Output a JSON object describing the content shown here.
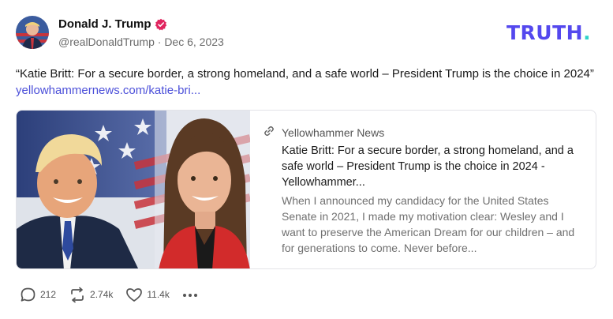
{
  "author": {
    "display_name": "Donald J. Trump",
    "handle": "@realDonaldTrump",
    "separator": " · ",
    "date": "Dec 6, 2023",
    "avatar_icon": "user-avatar",
    "verified_icon": "verified-badge-icon"
  },
  "brand": {
    "logo_main": "TRUTH",
    "logo_dot": ".",
    "primary_color": "#5448ee",
    "accent_color": "#2fd3c9"
  },
  "post": {
    "text": "“Katie Britt: For a secure border, a strong homeland, and a safe world – President Trump is the choice in 2024” ",
    "link_text": "yellowhammernews.com/katie-bri..."
  },
  "link_card": {
    "source": "Yellowhammer News",
    "title": "Katie Britt: For a secure border, a strong homeland, and a safe world – President Trump is the choice in 2024 - Yellowhammer...",
    "description": "When I announced my candidacy for the United States Senate in 2021, I made my motivation clear: Wesley and I want to preserve the American Dream for our children – and for generations to come. Never before...",
    "link_icon": "link-icon"
  },
  "actions": {
    "replies": "212",
    "reposts": "2.74k",
    "likes": "11.4k",
    "reply_icon": "reply-icon",
    "repost_icon": "repost-icon",
    "like_icon": "heart-icon",
    "more_icon": "more-options-icon"
  }
}
